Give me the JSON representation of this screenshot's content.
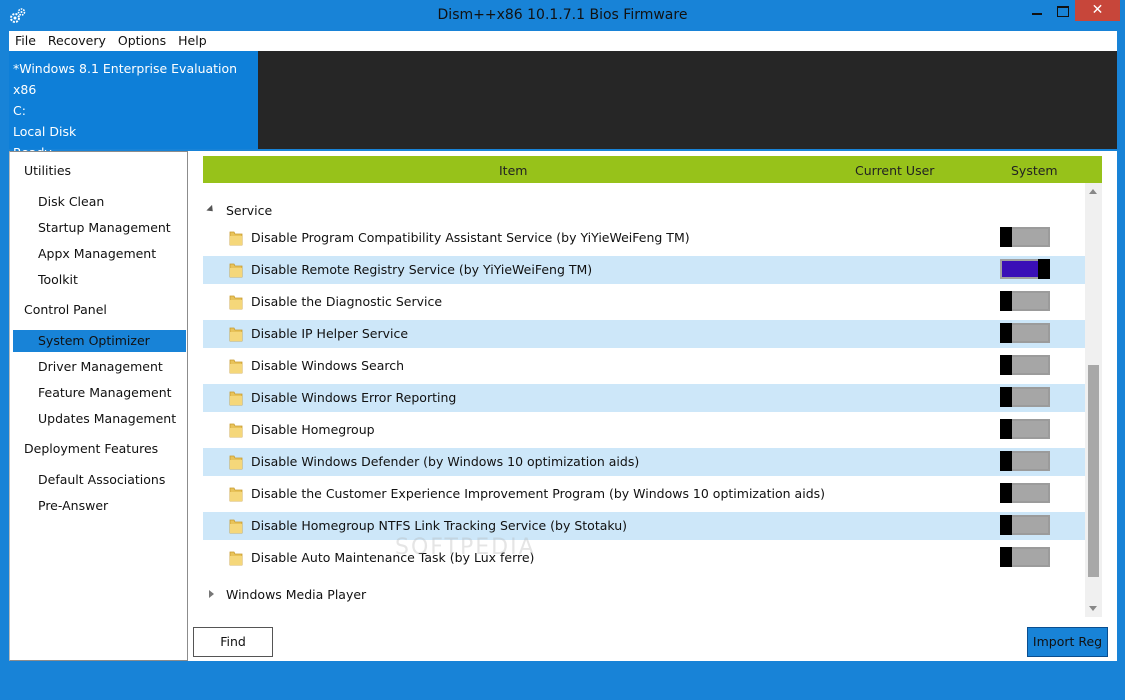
{
  "window": {
    "title": "Dism++x86 10.1.7.1 Bios Firmware",
    "close_glyph": "✕"
  },
  "menu": [
    "File",
    "Recovery",
    "Options",
    "Help"
  ],
  "info": {
    "os": "*Windows 8.1 Enterprise Evaluation x86",
    "drive": "C:",
    "disk": "Local Disk",
    "status": "Ready"
  },
  "sidebar": {
    "groups": [
      {
        "label": "Utilities",
        "items": [
          "Disk Clean",
          "Startup Management",
          "Appx Management",
          "Toolkit"
        ]
      },
      {
        "label": "Control Panel",
        "items": [
          "System Optimizer",
          "Driver Management",
          "Feature Management",
          "Updates Management"
        ]
      },
      {
        "label": "Deployment Features",
        "items": [
          "Default Associations",
          "Pre-Answer"
        ]
      }
    ],
    "active": "System Optimizer"
  },
  "table": {
    "headers": {
      "item": "Item",
      "current_user": "Current User",
      "system": "System"
    },
    "groups": [
      {
        "label": "Service",
        "expanded": true,
        "rows": [
          {
            "label": "Disable Program Compatibility Assistant Service (by YiYieWeiFeng TM)",
            "system_on": false
          },
          {
            "label": "Disable Remote Registry Service (by YiYieWeiFeng TM)",
            "system_on": true
          },
          {
            "label": "Disable the Diagnostic Service",
            "system_on": false
          },
          {
            "label": "Disable IP Helper Service",
            "system_on": false
          },
          {
            "label": "Disable Windows Search",
            "system_on": false
          },
          {
            "label": "Disable Windows Error Reporting",
            "system_on": false
          },
          {
            "label": "Disable Homegroup",
            "system_on": false
          },
          {
            "label": "Disable Windows Defender (by Windows 10 optimization aids)",
            "system_on": false
          },
          {
            "label": "Disable the Customer Experience Improvement Program (by Windows 10 optimization aids)",
            "system_on": false
          },
          {
            "label": "Disable Homegroup NTFS Link Tracking Service (by Stotaku)",
            "system_on": false
          },
          {
            "label": "Disable Auto Maintenance Task (by Lux ferre)",
            "system_on": false
          }
        ]
      },
      {
        "label": "Windows Media Player",
        "expanded": false,
        "rows": []
      }
    ]
  },
  "buttons": {
    "find": "Find",
    "import_reg": "Import Reg"
  },
  "watermark": "SOFTPEDIA",
  "colors": {
    "accent": "#1883d7",
    "header_green": "#97c21a",
    "row_alt": "#cde7f9",
    "toggle_on": "#3a0fb7"
  }
}
